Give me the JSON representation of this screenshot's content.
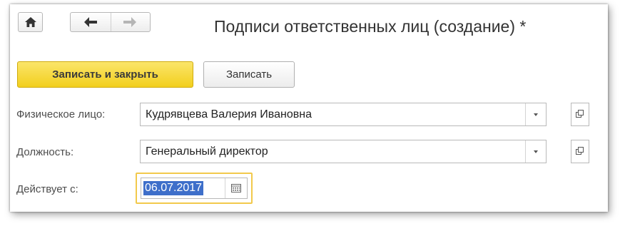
{
  "window": {
    "title": "Подписи ответственных лиц (создание) *"
  },
  "toolbar": {
    "save_close_label": "Записать и закрыть",
    "save_label": "Записать"
  },
  "form": {
    "person": {
      "label": "Физическое лицо:",
      "value": "Кудрявцева Валерия Ивановна"
    },
    "position": {
      "label": "Должность:",
      "value": "Генеральный директор"
    },
    "valid_from": {
      "label": "Действует с:",
      "value": "06.07.2017"
    }
  },
  "colors": {
    "primary_button": "#f5d327",
    "focus_border": "#f2c94c",
    "selection": "#3e6fca"
  },
  "icons": [
    "home-icon",
    "back-arrow-icon",
    "forward-arrow-icon",
    "dropdown-icon",
    "open-icon",
    "calendar-icon"
  ]
}
